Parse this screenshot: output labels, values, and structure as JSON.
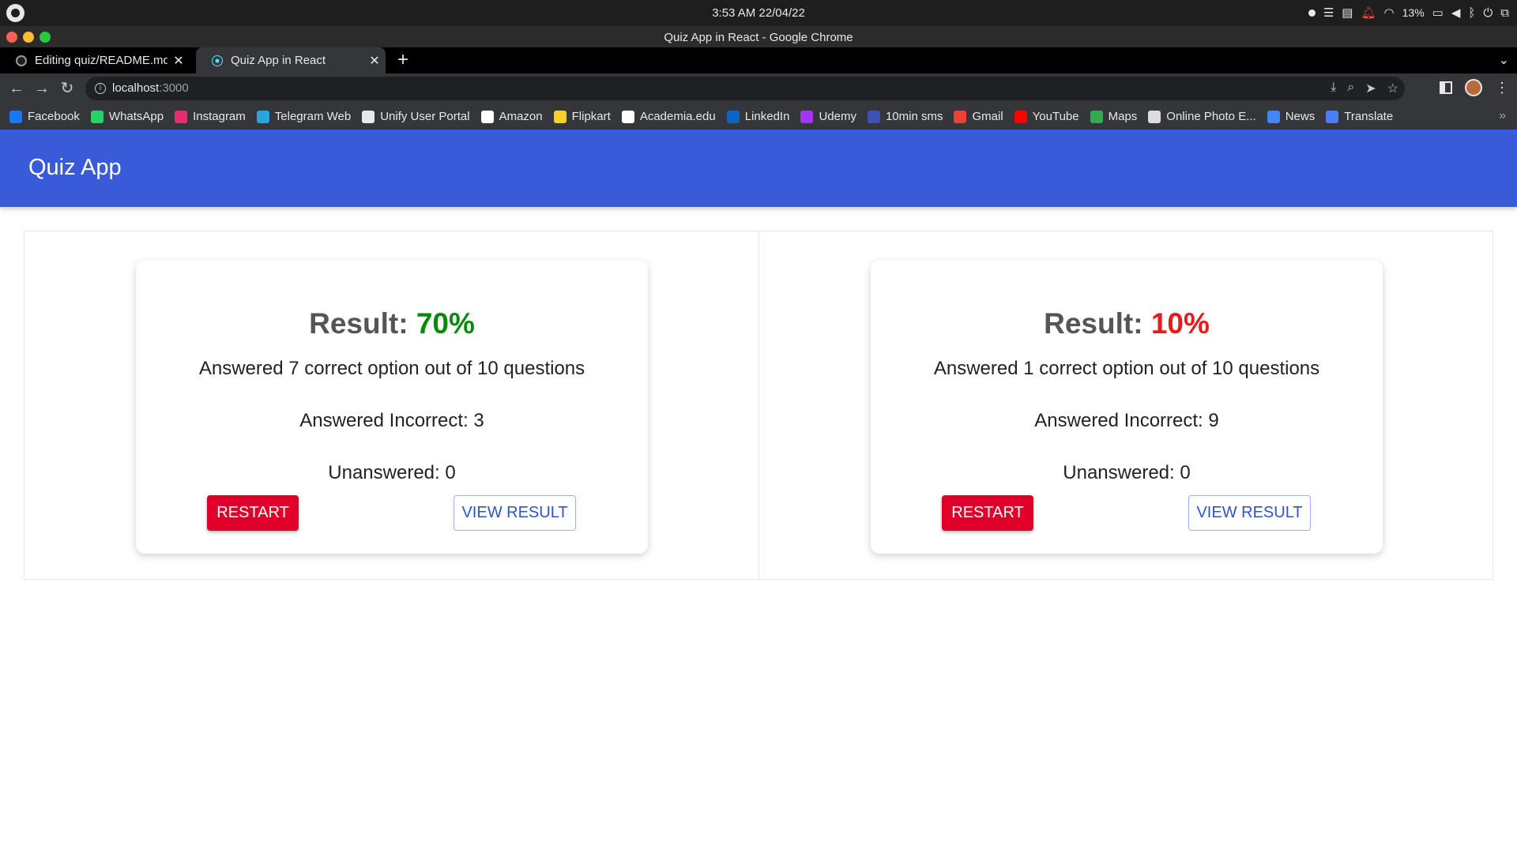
{
  "os_bar": {
    "clock": "3:53 AM  22/04/22",
    "battery": "13%"
  },
  "window": {
    "title": "Quiz App in React - Google Chrome"
  },
  "tabs": [
    {
      "label": "Editing quiz/README.md",
      "favicon": "github-icon"
    },
    {
      "label": "Quiz App in React",
      "favicon": "react-icon",
      "active": true
    }
  ],
  "address_bar": {
    "host": "localhost",
    "port": ":3000"
  },
  "bookmarks": [
    {
      "label": "Facebook",
      "color": "#1877f2"
    },
    {
      "label": "WhatsApp",
      "color": "#25d366"
    },
    {
      "label": "Instagram",
      "color": "#e1306c"
    },
    {
      "label": "Telegram Web",
      "color": "#2aa3e0"
    },
    {
      "label": "Unify User Portal",
      "color": "#e8e8e8"
    },
    {
      "label": "Amazon",
      "color": "#ffffff"
    },
    {
      "label": "Flipkart",
      "color": "#f7d02c"
    },
    {
      "label": "Academia.edu",
      "color": "#ffffff"
    },
    {
      "label": "LinkedIn",
      "color": "#0a66c2"
    },
    {
      "label": "Udemy",
      "color": "#a435f0"
    },
    {
      "label": "10min sms",
      "color": "#3f51b5"
    },
    {
      "label": "Gmail",
      "color": "#ea4335"
    },
    {
      "label": "YouTube",
      "color": "#ff0000"
    },
    {
      "label": "Maps",
      "color": "#34a853"
    },
    {
      "label": "Online Photo E...",
      "color": "#dddddd"
    },
    {
      "label": "News",
      "color": "#4285f4"
    },
    {
      "label": "Translate",
      "color": "#4a7ef5"
    }
  ],
  "app": {
    "title": "Quiz App",
    "header_color": "#3a5bd9"
  },
  "results": [
    {
      "label": "Result: ",
      "percent": "70%",
      "correct_text": "Answered 7 correct option out of 10 questions",
      "incorrect_text": "Answered Incorrect: 3",
      "unanswered_text": "Unanswered: 0",
      "restart_label": "RESTART",
      "view_label": "VIEW RESULT"
    },
    {
      "label": "Result: ",
      "percent": "10%",
      "correct_text": "Answered 1 correct option out of 10 questions",
      "incorrect_text": "Answered Incorrect: 9",
      "unanswered_text": "Unanswered: 0",
      "restart_label": "RESTART",
      "view_label": "VIEW RESULT"
    }
  ]
}
